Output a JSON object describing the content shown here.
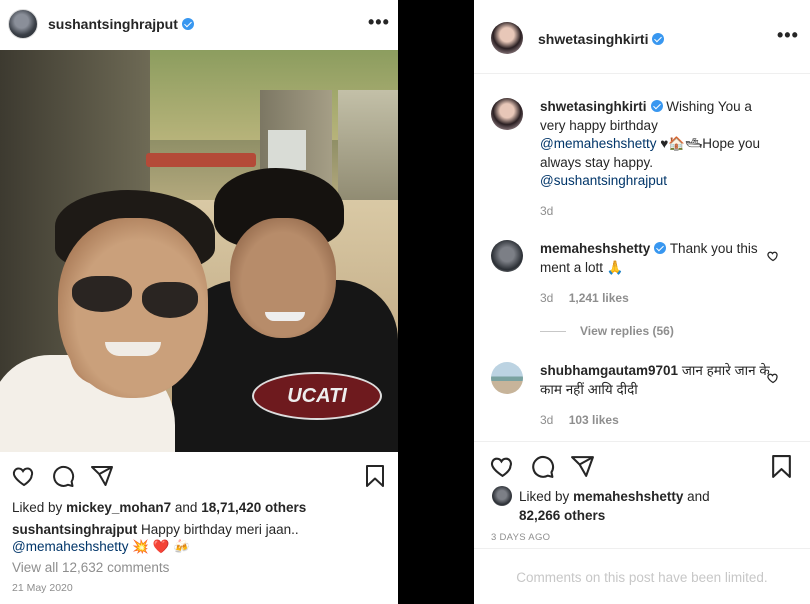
{
  "left_post": {
    "username": "sushantsinghrajput",
    "more_icon": "more-horizontal-icon",
    "photo_logo_text": "UCATI",
    "likes_prefix": "Liked by",
    "likes_user": "mickey_mohan7",
    "likes_suffix": "and",
    "likes_others": "18,71,420 others",
    "caption_user": "sushantsinghrajput",
    "caption_text": "Happy birthday meri jaan..",
    "caption_mention": "@memaheshshetty",
    "caption_emojis": "💥 ❤️ 🍻",
    "view_all": "View all 12,632 comments",
    "date": "21 May 2020"
  },
  "right_panel": {
    "header_user": "shwetasinghkirti",
    "comments": [
      {
        "user": "shwetasinghkirti",
        "text_1": "Wishing You a very happy birthday",
        "mention_1": "@memaheshshetty",
        "text_2": "♥🏠🛥Hope you always stay happy.",
        "mention_2": "@sushantsinghrajput",
        "time": "3d"
      },
      {
        "user": "memaheshshetty",
        "text": "Thank you this ment a lott 🙏",
        "time": "3d",
        "likes": "1,241 likes",
        "view_replies": "View replies (56)"
      },
      {
        "user": "shubhamgautam9701",
        "text": "जान हमारे जान के काम नहीं आयि दीदी",
        "time": "3d",
        "likes": "103 likes"
      }
    ],
    "liked_prefix": "Liked by",
    "liked_user": "memaheshshetty",
    "liked_suffix": "and",
    "liked_others": "82,266 others",
    "date": "3 DAYS AGO",
    "limited": "Comments on this post have been limited."
  },
  "icons": {
    "heart": "heart-icon",
    "comment": "comment-icon",
    "share": "share-icon",
    "save": "bookmark-icon",
    "verified": "verified-badge-icon"
  },
  "colors": {
    "background": "#000000",
    "panel": "#ffffff",
    "text": "#262626",
    "secondary": "#8e8e8e",
    "link": "#003569",
    "verified": "#3897f0"
  }
}
